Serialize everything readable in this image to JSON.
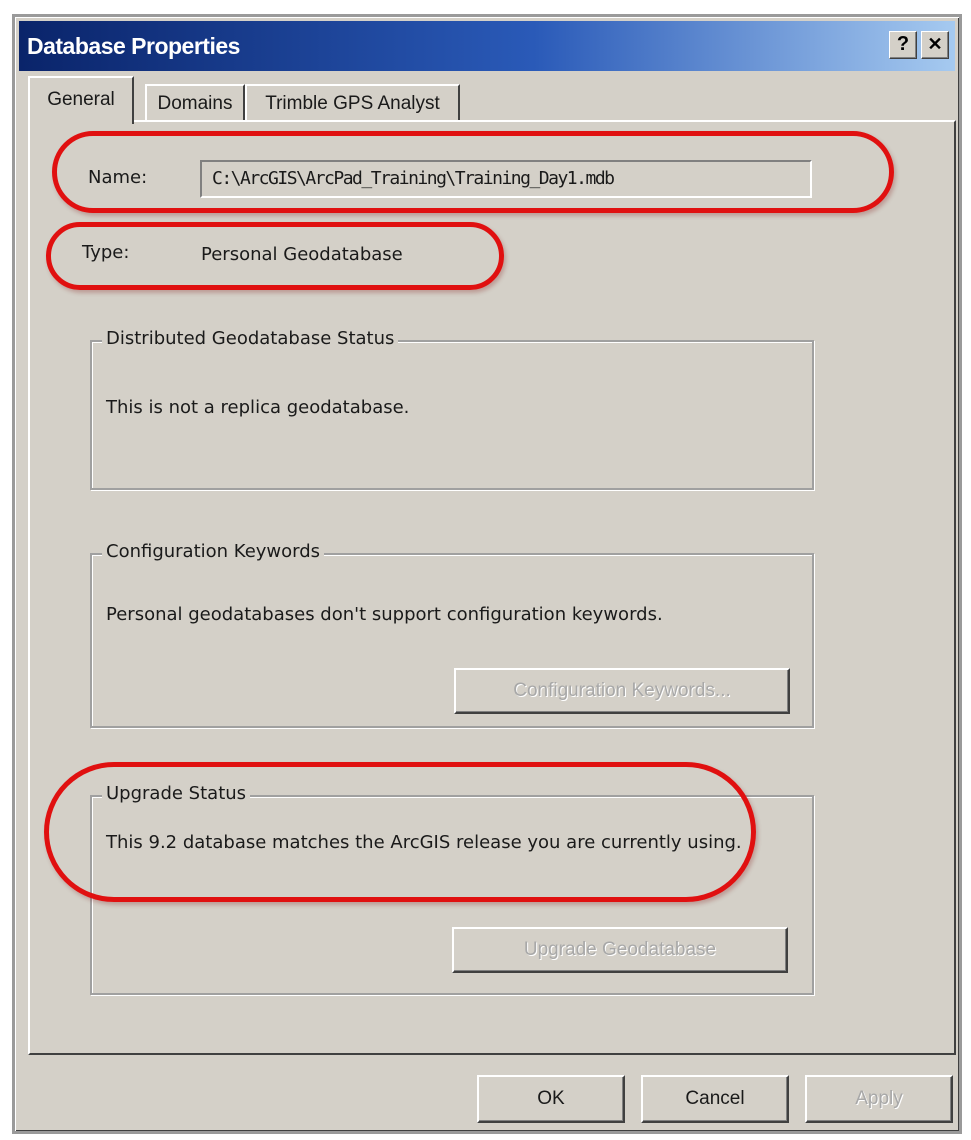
{
  "window": {
    "title": "Database Properties",
    "help_btn": "?",
    "close_btn": "✕"
  },
  "tabs": [
    "General",
    "Domains",
    "Trimble GPS Analyst"
  ],
  "general": {
    "name_label": "Name:",
    "name_value": "C:\\ArcGIS\\ArcPad_Training\\Training_Day1.mdb",
    "type_label": "Type:",
    "type_value": "Personal Geodatabase"
  },
  "distributed": {
    "title": "Distributed Geodatabase Status",
    "text": "This is not a replica geodatabase."
  },
  "config": {
    "title": "Configuration Keywords",
    "text": "Personal geodatabases don't support configuration keywords.",
    "button": "Configuration Keywords..."
  },
  "upgrade": {
    "title": "Upgrade Status",
    "text": "This 9.2 database matches the ArcGIS release you are currently using.",
    "button": "Upgrade Geodatabase"
  },
  "footer": {
    "ok": "OK",
    "cancel": "Cancel",
    "apply": "Apply"
  },
  "colors": {
    "title_start": "#0a246a",
    "title_end": "#a6caf0",
    "highlight": "#e01010",
    "face": "#d4d0c8"
  }
}
